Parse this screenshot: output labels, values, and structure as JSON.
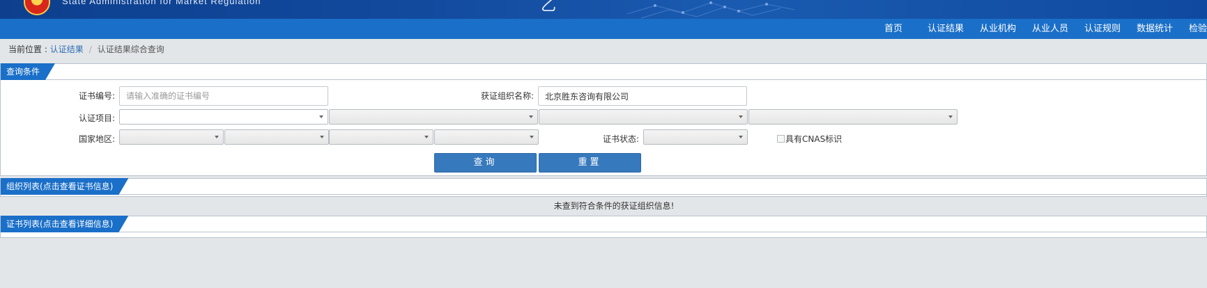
{
  "header": {
    "org_name_en": "State Administration  for  Market Regulation",
    "mid_glyph": "乙"
  },
  "nav": {
    "items": [
      "首页",
      "认证结果",
      "从业机构",
      "从业人员",
      "认证规则",
      "数据统计",
      "检验"
    ]
  },
  "breadcrumb": {
    "prefix": "当前位置 : ",
    "link": "认证结果",
    "separator": "/",
    "current": "认证结果综合查询"
  },
  "query_panel": {
    "title": "查询条件",
    "cert_no_label": "证书编号:",
    "cert_no_placeholder": "请输入准确的证书编号",
    "org_name_label": "获证组织名称:",
    "org_name_value": "北京胜东咨询有限公司",
    "cert_project_label": "认证项目:",
    "region_label": "国家地区:",
    "cert_status_label": "证书状态:",
    "cnas_label": "具有CNAS标识",
    "query_button": "查询",
    "reset_button": "重置"
  },
  "org_panel": {
    "title": "组织列表(点击查看证书信息)",
    "empty_message": "未查到符合条件的获证组织信息!"
  },
  "cert_panel": {
    "title": "证书列表(点击查看详细信息)"
  },
  "colors": {
    "nav_blue": "#1a6fc8",
    "button_blue": "#3779bd",
    "page_bg": "#e3e6e9"
  }
}
